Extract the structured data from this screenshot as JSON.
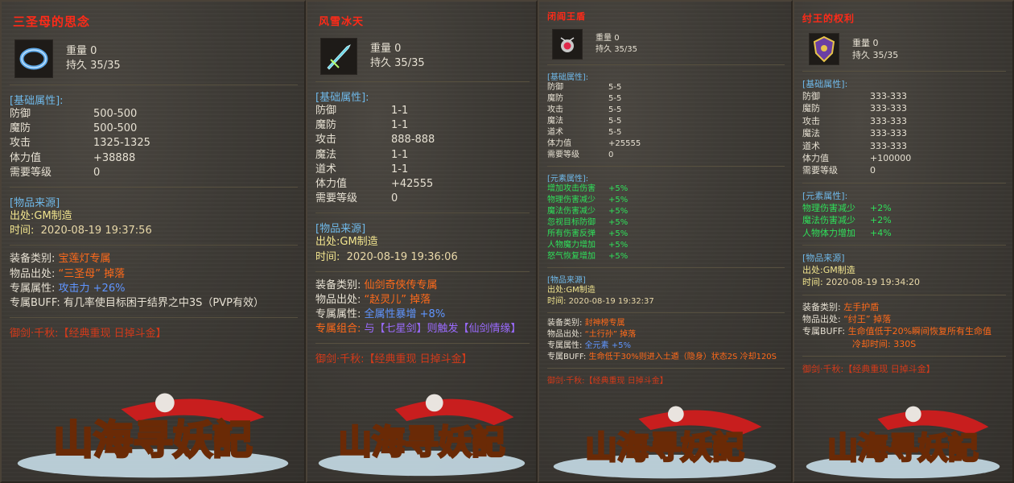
{
  "items": [
    {
      "name": "三圣母的思念",
      "weight_label": "重量",
      "weight": "0",
      "durability_label": "持久",
      "durability": "35/35",
      "base_header": "[基础属性]:",
      "stats": [
        {
          "k": "防御",
          "v": "500-500"
        },
        {
          "k": "魔防",
          "v": "500-500"
        },
        {
          "k": "攻击",
          "v": "1325-1325"
        },
        {
          "k": "体力值",
          "v": "+38888"
        },
        {
          "k": "需要等级",
          "v": "0"
        }
      ],
      "source_header": "[物品来源]",
      "source_label": "出处:",
      "source": "GM制造",
      "time_label": "时间:",
      "time": "2020-08-19 19:37:56",
      "equip_label": "装备类别:",
      "equip_value": "宝莲灯专属",
      "origin_label": "物品出处:",
      "origin_value": "“三圣母” 掉落",
      "exclusive_label": "专属属性:",
      "exclusive_value": "攻击力 +26%",
      "buff_label": "专属BUFF:",
      "buff_value": "有几率使目标困于结界之中3S（PVP有效）",
      "slogan": "御剑·千秋:【经典重现 日掉斗金】"
    },
    {
      "name": "风雪冰天",
      "weight_label": "重量",
      "weight": "0",
      "durability_label": "持久",
      "durability": "35/35",
      "base_header": "[基础属性]:",
      "stats": [
        {
          "k": "防御",
          "v": "1-1"
        },
        {
          "k": "魔防",
          "v": "1-1"
        },
        {
          "k": "攻击",
          "v": "888-888"
        },
        {
          "k": "魔法",
          "v": "1-1"
        },
        {
          "k": "道术",
          "v": "1-1"
        },
        {
          "k": "体力值",
          "v": "+42555"
        },
        {
          "k": "需要等级",
          "v": "0"
        }
      ],
      "source_header": "[物品来源]",
      "source_label": "出处:",
      "source": "GM制造",
      "time_label": "时间:",
      "time": "2020-08-19 19:36:06",
      "equip_label": "装备类别:",
      "equip_value": "仙剑奇侠传专属",
      "origin_label": "物品出处:",
      "origin_value": "“赵灵儿” 掉落",
      "exclusive_label": "专属属性:",
      "exclusive_value": "全属性暴增 +8%",
      "combo_label": "专属组合:",
      "combo_value": "与【七星剑】则触发【仙剑情缘】",
      "slogan": "御剑·千秋:【经典重现 日掉斗金】"
    },
    {
      "name": "闭阎王盾",
      "weight_label": "重量",
      "weight": "0",
      "durability_label": "持久",
      "durability": "35/35",
      "base_header": "[基础属性]:",
      "stats": [
        {
          "k": "防御",
          "v": "5-5"
        },
        {
          "k": "魔防",
          "v": "5-5"
        },
        {
          "k": "攻击",
          "v": "5-5"
        },
        {
          "k": "魔法",
          "v": "5-5"
        },
        {
          "k": "道术",
          "v": "5-5"
        },
        {
          "k": "体力值",
          "v": "+25555"
        },
        {
          "k": "需要等级",
          "v": "0"
        }
      ],
      "element_header": "[元素属性]:",
      "elements": [
        {
          "k": "增加攻击伤害",
          "v": "+5%"
        },
        {
          "k": "物理伤害减少",
          "v": "+5%"
        },
        {
          "k": "魔法伤害减少",
          "v": "+5%"
        },
        {
          "k": "忽视目标防御",
          "v": "+5%"
        },
        {
          "k": "所有伤害反弹",
          "v": "+5%"
        },
        {
          "k": "人物魔力增加",
          "v": "+5%"
        },
        {
          "k": "怒气恢复增加",
          "v": "+5%"
        }
      ],
      "source_header": "[物品来源]",
      "source_label": "出处:",
      "source": "GM制造",
      "time_label": "时间:",
      "time": "2020-08-19 19:32:37",
      "equip_label": "装备类别:",
      "equip_value": "封神榜专属",
      "origin_label": "物品出处:",
      "origin_value": "“土行孙” 掉落",
      "exclusive_label": "专属属性:",
      "exclusive_value": "全元素 +5%",
      "buff_label": "专属BUFF:",
      "buff_value": "生命低于30%则进入土遁（隐身）状态2S 冷却120S",
      "slogan": "御剑·千秋:【经典重现 日掉斗金】"
    },
    {
      "name": "纣王的权利",
      "weight_label": "重量",
      "weight": "0",
      "durability_label": "持久",
      "durability": "35/35",
      "base_header": "[基础属性]:",
      "stats": [
        {
          "k": "防御",
          "v": "333-333"
        },
        {
          "k": "魔防",
          "v": "333-333"
        },
        {
          "k": "攻击",
          "v": "333-333"
        },
        {
          "k": "魔法",
          "v": "333-333"
        },
        {
          "k": "道术",
          "v": "333-333"
        },
        {
          "k": "体力值",
          "v": "+100000"
        },
        {
          "k": "需要等级",
          "v": "0"
        }
      ],
      "element_header": "[元素属性]:",
      "elements": [
        {
          "k": "物理伤害减少",
          "v": "+2%"
        },
        {
          "k": "魔法伤害减少",
          "v": "+2%"
        },
        {
          "k": "人物体力增加",
          "v": "+4%"
        }
      ],
      "source_header": "[物品来源]",
      "source_label": "出处:",
      "source": "GM制造",
      "time_label": "时间:",
      "time": "2020-08-19 19:34:20",
      "equip_label": "装备类别:",
      "equip_value": "左手护盾",
      "origin_label": "物品出处:",
      "origin_value": "“纣王” 掉落",
      "buff_label": "专属BUFF:",
      "buff_value": "生命值低于20%瞬间恢复所有生命值",
      "buff_value2": "冷却时间: 330S",
      "slogan": "御剑·千秋:【经典重现 日掉斗金】"
    }
  ],
  "logo_text": "山海寻妖記",
  "colors": {
    "title": "#ff2a18",
    "header": "#6fb8e8",
    "element": "#2fe05a",
    "equip": "#ff6a1a",
    "time": "#f1e48e"
  }
}
